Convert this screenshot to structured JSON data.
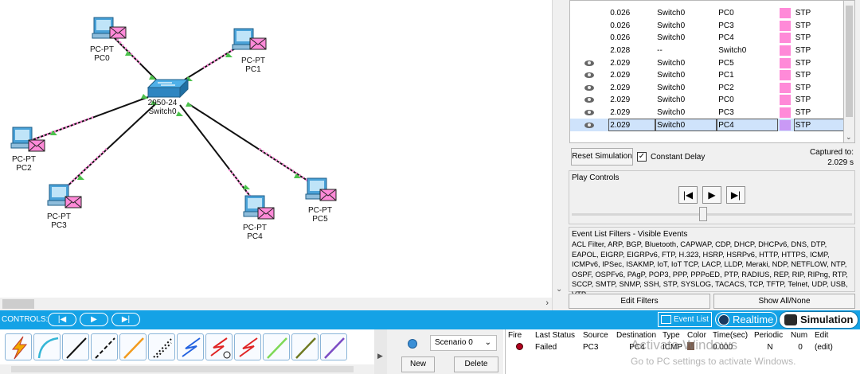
{
  "workspace": {
    "devices": [
      {
        "type": "PC-PT",
        "name": "PC0"
      },
      {
        "type": "PC-PT",
        "name": "PC1"
      },
      {
        "type": "PC-PT",
        "name": "PC2"
      },
      {
        "type": "PC-PT",
        "name": "PC3"
      },
      {
        "type": "PC-PT",
        "name": "PC4"
      },
      {
        "type": "PC-PT",
        "name": "PC5"
      }
    ],
    "switch": {
      "type": "2950-24",
      "name": "Switch0"
    }
  },
  "event_list": {
    "rows": [
      {
        "vis": "",
        "time": "0.026",
        "last_device": "Switch0",
        "at_device": "PC0",
        "type": "STP"
      },
      {
        "vis": "",
        "time": "0.026",
        "last_device": "Switch0",
        "at_device": "PC3",
        "type": "STP"
      },
      {
        "vis": "",
        "time": "0.026",
        "last_device": "Switch0",
        "at_device": "PC4",
        "type": "STP"
      },
      {
        "vis": "",
        "time": "2.028",
        "last_device": "--",
        "at_device": "Switch0",
        "type": "STP"
      },
      {
        "vis": "eye",
        "time": "2.029",
        "last_device": "Switch0",
        "at_device": "PC5",
        "type": "STP"
      },
      {
        "vis": "eye",
        "time": "2.029",
        "last_device": "Switch0",
        "at_device": "PC1",
        "type": "STP"
      },
      {
        "vis": "eye",
        "time": "2.029",
        "last_device": "Switch0",
        "at_device": "PC2",
        "type": "STP"
      },
      {
        "vis": "eye",
        "time": "2.029",
        "last_device": "Switch0",
        "at_device": "PC0",
        "type": "STP"
      },
      {
        "vis": "eye",
        "time": "2.029",
        "last_device": "Switch0",
        "at_device": "PC3",
        "type": "STP"
      },
      {
        "vis": "eye",
        "time": "2.029",
        "last_device": "Switch0",
        "at_device": "PC4",
        "type": "STP",
        "selected": true
      }
    ],
    "swatch_color": "#ff8ad8",
    "selected_swatch_color": "#c999f5",
    "reset_label": "Reset Simulation",
    "constant_delay_label": "Constant Delay",
    "constant_delay_checked": true,
    "captured_label": "Captured to:",
    "captured_value": "2.029 s"
  },
  "play_controls": {
    "title": "Play Controls",
    "back_icon": "step-back-icon",
    "play_icon": "play-icon",
    "forward_icon": "step-forward-icon"
  },
  "filters": {
    "title": "Event List Filters - Visible Events",
    "text": "ACL Filter, ARP, BGP, Bluetooth, CAPWAP, CDP, DHCP, DHCPv6, DNS, DTP, EAPOL, EIGRP, EIGRPv6, FTP, H.323, HSRP, HSRPv6, HTTP, HTTPS, ICMP, ICMPv6, IPSec, ISAKMP, IoT, IoT TCP, LACP, LLDP, Meraki, NDP, NETFLOW, NTP, OSPF, OSPFv6, PAgP, POP3, PPP, PPPoED, PTP, RADIUS, REP, RIP, RIPng, RTP, SCCP, SMTP, SNMP, SSH, STP, SYSLOG, TACACS, TCP, TFTP, Telnet, UDP, USB, VTP",
    "edit_label": "Edit Filters",
    "show_all_label": "Show All/None"
  },
  "toolbar": {
    "controls_label": "CONTROLS:",
    "event_list_label": "Event List",
    "realtime_label": "Realtime",
    "simulation_label": "Simulation",
    "accent": "#14a2e6"
  },
  "scenario": {
    "selected": "Scenario 0",
    "new_label": "New",
    "delete_label": "Delete"
  },
  "pdu_list": {
    "headers": [
      "Fire",
      "Last Status",
      "Source",
      "Destination",
      "Type",
      "Color",
      "Time(sec)",
      "Periodic",
      "Num",
      "Edit"
    ],
    "rows": [
      {
        "last_status": "Failed",
        "source": "PC3",
        "destination": "PC4",
        "type": "ICMP",
        "time": "0.000",
        "periodic": "N",
        "num": "0",
        "edit": "(edit)"
      }
    ]
  },
  "watermark": {
    "title": "Activate Windows",
    "subtitle": "Go to PC settings to activate Windows."
  }
}
